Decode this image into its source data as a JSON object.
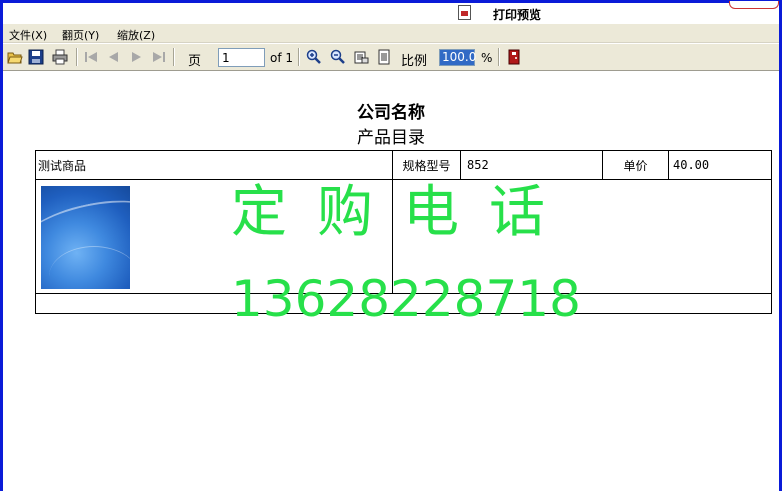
{
  "window": {
    "title": "打印预览"
  },
  "menu": [
    "文件(X)",
    "翻页(Y)",
    "缩放(Z)"
  ],
  "toolbar": {
    "page_label": "页",
    "page_value": "1",
    "page_of": "of 1",
    "zoom_label": "比例",
    "zoom_value": "100.0",
    "zoom_unit": "%"
  },
  "document": {
    "company": "公司名称",
    "subtitle": "产品目录",
    "product": {
      "name": "测试商品",
      "spec_label": "规格型号",
      "spec_value": "852",
      "price_label": "单价",
      "price_value": "40.00"
    },
    "watermark": {
      "line1": "定购电话",
      "line2": "13628228718"
    }
  },
  "colors": {
    "accent": "#0a1bd8",
    "watermark": "#27e04a",
    "selection": "#316ac5"
  }
}
